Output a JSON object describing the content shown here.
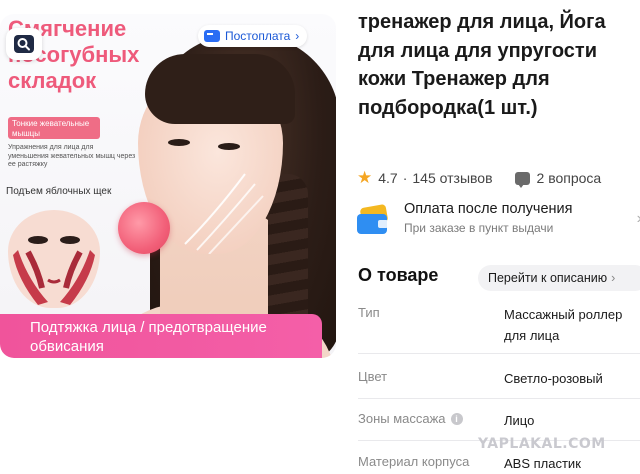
{
  "image": {
    "promo_heading": "Смягчение\nносогубных\nскладок",
    "muscle_badge": "Тонкие жевательные мышцы",
    "exercise_note": "Упражнения для лица для уменьшения жевательных мышц через ее растяжку",
    "cheek_label": "Подъем яблочных щек",
    "banner": "Подтяжка лица / предотвращение обвисания",
    "postpay_chip": "Постоплата"
  },
  "product": {
    "title": "тренажер для лица, Йога для лица для упругости кожи Тренажер для подбородка(1 шт.)",
    "rating": "4.7",
    "reviews": "145 отзывов",
    "questions": "2 вопроса"
  },
  "payment": {
    "title": "Оплата после получения",
    "subtitle": "При заказе в пункт выдачи"
  },
  "about": {
    "heading": "О товаре",
    "describe_button": "Перейти к описанию",
    "specs": [
      {
        "label": "Тип",
        "value": "Массажный роллер для лица"
      },
      {
        "label": "Цвет",
        "value": "Светло-розовый"
      },
      {
        "label": "Зоны массажа",
        "value": "Лицо"
      },
      {
        "label": "Материал корпуса",
        "value": "ABS пластик"
      }
    ]
  },
  "watermark": "YAPLAKAL.COM",
  "colors": {
    "accent_pink": "#f0549b",
    "link_blue": "#1a58d6",
    "star": "#f5a623"
  },
  "icons": [
    "image-search-icon",
    "wallet-icon",
    "star-icon",
    "question-bubble-icon",
    "info-icon",
    "chevron-right-icon"
  ]
}
